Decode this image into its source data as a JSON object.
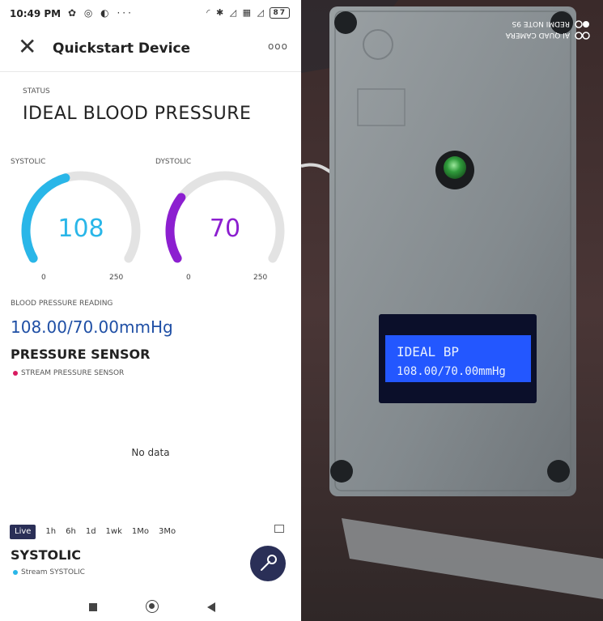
{
  "statusbar": {
    "time": "10:49 PM",
    "icons": "✿ ◎ ◐ ···",
    "right_icons": "◜ ✱ ◿ ▦ ◿",
    "battery": "87"
  },
  "appbar": {
    "title": "Quickstart Device",
    "more": "ooo"
  },
  "status": {
    "label": "STATUS",
    "value": "IDEAL BLOOD PRESSURE"
  },
  "gauges": [
    {
      "label": "SYSTOLIC",
      "value": 108,
      "min": 0,
      "max": 250,
      "color": "#29b6e8"
    },
    {
      "label": "DYSTOLIC",
      "value": 70,
      "min": 0,
      "max": 250,
      "color": "#8c1fd0"
    }
  ],
  "reading": {
    "label": "BLOOD PRESSURE READING",
    "value": "108.00/70.00mmHg"
  },
  "pressure_sensor": {
    "title": "PRESSURE SENSOR",
    "legend": "STREAM PRESSURE SENSOR",
    "legend_color": "#d81b60",
    "empty_text": "No data"
  },
  "time_ranges": [
    "Live",
    "1h",
    "6h",
    "1d",
    "1wk",
    "1Mo",
    "3Mo"
  ],
  "systolic_chart": {
    "title": "SYSTOLIC",
    "legend": "Stream SYSTOLIC",
    "legend_color": "#29b6e8"
  },
  "photo": {
    "lcd_line1": "IDEAL BP",
    "lcd_line2": "108.00/70.00mmHg",
    "watermark_line1": "AI QUAD CAMERA",
    "watermark_line2": "REDMI NOTE 9S"
  }
}
